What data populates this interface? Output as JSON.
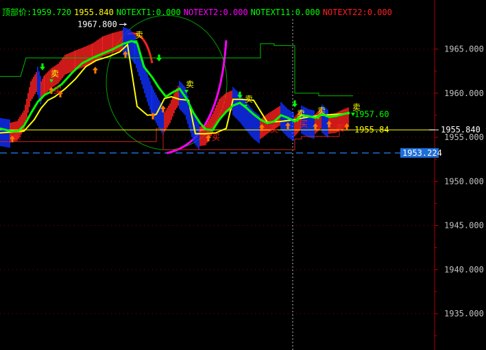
{
  "header": {
    "items": [
      {
        "text": "顶部价:1959.720",
        "color": "#00ff00"
      },
      {
        "text": "1955.840",
        "color": "#ffff00"
      },
      {
        "text": "NOTEXT1:0.000",
        "color": "#00ff00"
      },
      {
        "text": "NOTEXT2:0.000",
        "color": "#ff00ff"
      },
      {
        "text": "NOTEXT11:0.000",
        "color": "#00ff00"
      },
      {
        "text": "NOTEXT22:0.000",
        "color": "#ff2020"
      }
    ]
  },
  "chart_data": {
    "type": "line",
    "ylim": [
      1931.5,
      1969.4
    ],
    "y_ticks": [
      "1965.000",
      "1960.000",
      "1955.000",
      "1950.000",
      "1945.000",
      "1940.000",
      "1935.000"
    ],
    "y_tick_values": [
      1965,
      1960,
      1955,
      1950,
      1945,
      1940,
      1935
    ],
    "current_price": {
      "label": "1953.224",
      "value": 1953.224,
      "color": "#1e6ed8"
    },
    "reference_price": {
      "label": "1955.840",
      "value": 1955.84
    },
    "peak_label": {
      "label": "1967.800",
      "value": 1967.8
    },
    "inline_labels": [
      {
        "text": "1957.60",
        "value": 1957.6,
        "color": "#00ff00"
      },
      {
        "text": "1955.84",
        "value": 1955.84,
        "color": "#ffff00"
      }
    ],
    "signal_text": {
      "buy": "买",
      "sell": "卖"
    },
    "colors": {
      "upper_band": "#00c000",
      "lower_band": "#d02020",
      "yellow": "#ffff00",
      "green": "#00ff00",
      "magenta": "#ff00ff",
      "red_arc": "#ff2020",
      "circle": "#00a000",
      "blue": "#1030ff",
      "candle_red": "#ff2020",
      "grid": "#8b0000",
      "cursor": "#c0c0c0",
      "dashed": "#1e6ed8"
    },
    "series": [
      {
        "key": "upper_band",
        "x": [
          0,
          30,
          38,
          380,
          380,
          400,
          400,
          430,
          430,
          465,
          465,
          515
        ],
        "values": [
          1961.9,
          1961.9,
          1964.0,
          1964.0,
          1965.6,
          1965.6,
          1965.4,
          1965.4,
          1960.0,
          1960.0,
          1959.7,
          1959.7
        ]
      },
      {
        "key": "yellow",
        "x": [
          0,
          20,
          35,
          50,
          60,
          70,
          80,
          95,
          110,
          125,
          140,
          160,
          175,
          186,
          200,
          215,
          228,
          240,
          250,
          262,
          275,
          285,
          300,
          315,
          330,
          340,
          350,
          370,
          390,
          410,
          430,
          450,
          470,
          490,
          510
        ],
        "values": [
          1955.5,
          1955.6,
          1955.7,
          1957.0,
          1958.3,
          1959.2,
          1959.6,
          1960.5,
          1961.6,
          1963.0,
          1963.7,
          1964.2,
          1964.7,
          1965.5,
          1958.5,
          1957.5,
          1957.6,
          1959.4,
          1959.6,
          1959.3,
          1959.2,
          1955.4,
          1955.4,
          1955.5,
          1956.0,
          1959.3,
          1959.3,
          1959.2,
          1956.7,
          1956.8,
          1957.0,
          1957.3,
          1957.5,
          1957.6,
          1957.7
        ]
      },
      {
        "key": "lower_band",
        "x": [
          0,
          228,
          228,
          238,
          238,
          430,
          430,
          440,
          440,
          495,
          495,
          510
        ],
        "values": [
          1954.5,
          1954.5,
          1956.0,
          1956.0,
          1953.6,
          1953.6,
          1954.8,
          1954.8,
          1955.1,
          1955.1,
          1955.8,
          1955.8
        ]
      },
      {
        "key": "green",
        "x": [
          0,
          15,
          25,
          35,
          45,
          55,
          65,
          75,
          90,
          105,
          120,
          135,
          150,
          165,
          180,
          192,
          200,
          210,
          222,
          232,
          242,
          252,
          262,
          272,
          282,
          292,
          300,
          310,
          320,
          330,
          340,
          350,
          360,
          370,
          380,
          390,
          400,
          410,
          420,
          430,
          440,
          450,
          460,
          470,
          480,
          490,
          500,
          510
        ],
        "values": [
          1956.0,
          1955.7,
          1955.6,
          1956.3,
          1957.7,
          1959.0,
          1959.8,
          1960.2,
          1961.0,
          1962.3,
          1963.4,
          1964.0,
          1964.5,
          1965.0,
          1965.6,
          1965.9,
          1965.7,
          1963.0,
          1961.8,
          1960.6,
          1959.6,
          1960.1,
          1960.5,
          1959.4,
          1957.8,
          1956.6,
          1955.9,
          1955.8,
          1957.0,
          1957.9,
          1958.6,
          1958.9,
          1958.3,
          1957.6,
          1957.0,
          1956.6,
          1956.8,
          1957.5,
          1957.2,
          1956.8,
          1957.5,
          1957.4,
          1957.2,
          1957.6,
          1957.3,
          1957.4,
          1957.6,
          1957.8
        ]
      }
    ],
    "price_path": {
      "x": [
        0,
        15,
        25,
        35,
        45,
        55,
        60,
        65,
        75,
        85,
        95,
        110,
        120,
        135,
        150,
        165,
        180,
        190,
        197,
        207,
        215,
        222,
        232,
        240,
        248,
        256,
        262,
        270,
        282,
        292,
        300,
        310,
        320,
        330,
        340,
        350,
        360,
        370,
        380,
        390,
        400,
        410,
        420,
        430,
        440,
        450,
        460,
        470,
        480,
        490,
        500,
        510
      ],
      "values": [
        1956.0,
        1955.8,
        1956.0,
        1957.2,
        1960.5,
        1961.8,
        1960.5,
        1961.2,
        1962.0,
        1962.5,
        1963.5,
        1964.0,
        1964.3,
        1964.8,
        1965.6,
        1966.0,
        1966.3,
        1966.0,
        1965.3,
        1963.0,
        1961.0,
        1959.5,
        1958.0,
        1957.0,
        1958.0,
        1959.5,
        1960.2,
        1959.5,
        1956.5,
        1955.4,
        1955.5,
        1956.8,
        1958.5,
        1959.2,
        1959.5,
        1958.7,
        1957.7,
        1956.8,
        1956.2,
        1956.8,
        1957.3,
        1957.8,
        1957.0,
        1956.5,
        1957.4,
        1957.0,
        1956.8,
        1957.5,
        1956.8,
        1956.9,
        1957.3,
        1957.6
      ]
    },
    "sell_signals": [
      {
        "x": 80,
        "v": 1962.2
      },
      {
        "x": 203,
        "v": 1966.6
      },
      {
        "x": 277,
        "v": 1961.0
      },
      {
        "x": 363,
        "v": 1959.3
      },
      {
        "x": 439,
        "v": 1957.7
      },
      {
        "x": 469,
        "v": 1958.0
      },
      {
        "x": 520,
        "v": 1958.4
      }
    ],
    "buy_signals": [
      {
        "x": 25,
        "v": 1955.1
      },
      {
        "x": 84,
        "v": 1960.3
      },
      {
        "x": 315,
        "v": 1955.0
      },
      {
        "x": 400,
        "v": 1955.9
      },
      {
        "x": 443,
        "v": 1956.5
      },
      {
        "x": 496,
        "v": 1956.0
      }
    ],
    "up_arrows": [
      {
        "x": 18,
        "v": 1955.2
      },
      {
        "x": 75,
        "v": 1960.7
      },
      {
        "x": 88,
        "v": 1960.3
      },
      {
        "x": 139,
        "v": 1963.0
      },
      {
        "x": 183,
        "v": 1964.8
      },
      {
        "x": 223,
        "v": 1957.8
      },
      {
        "x": 238,
        "v": 1958.6
      },
      {
        "x": 304,
        "v": 1955.3
      },
      {
        "x": 382,
        "v": 1956.5
      },
      {
        "x": 420,
        "v": 1956.7
      },
      {
        "x": 460,
        "v": 1956.6
      },
      {
        "x": 480,
        "v": 1956.9
      },
      {
        "x": 506,
        "v": 1956.6
      }
    ],
    "down_arrows": [
      {
        "x": 62,
        "v": 1962.6
      },
      {
        "x": 232,
        "v": 1963.6
      },
      {
        "x": 350,
        "v": 1959.4
      },
      {
        "x": 430,
        "v": 1958.4
      }
    ]
  }
}
